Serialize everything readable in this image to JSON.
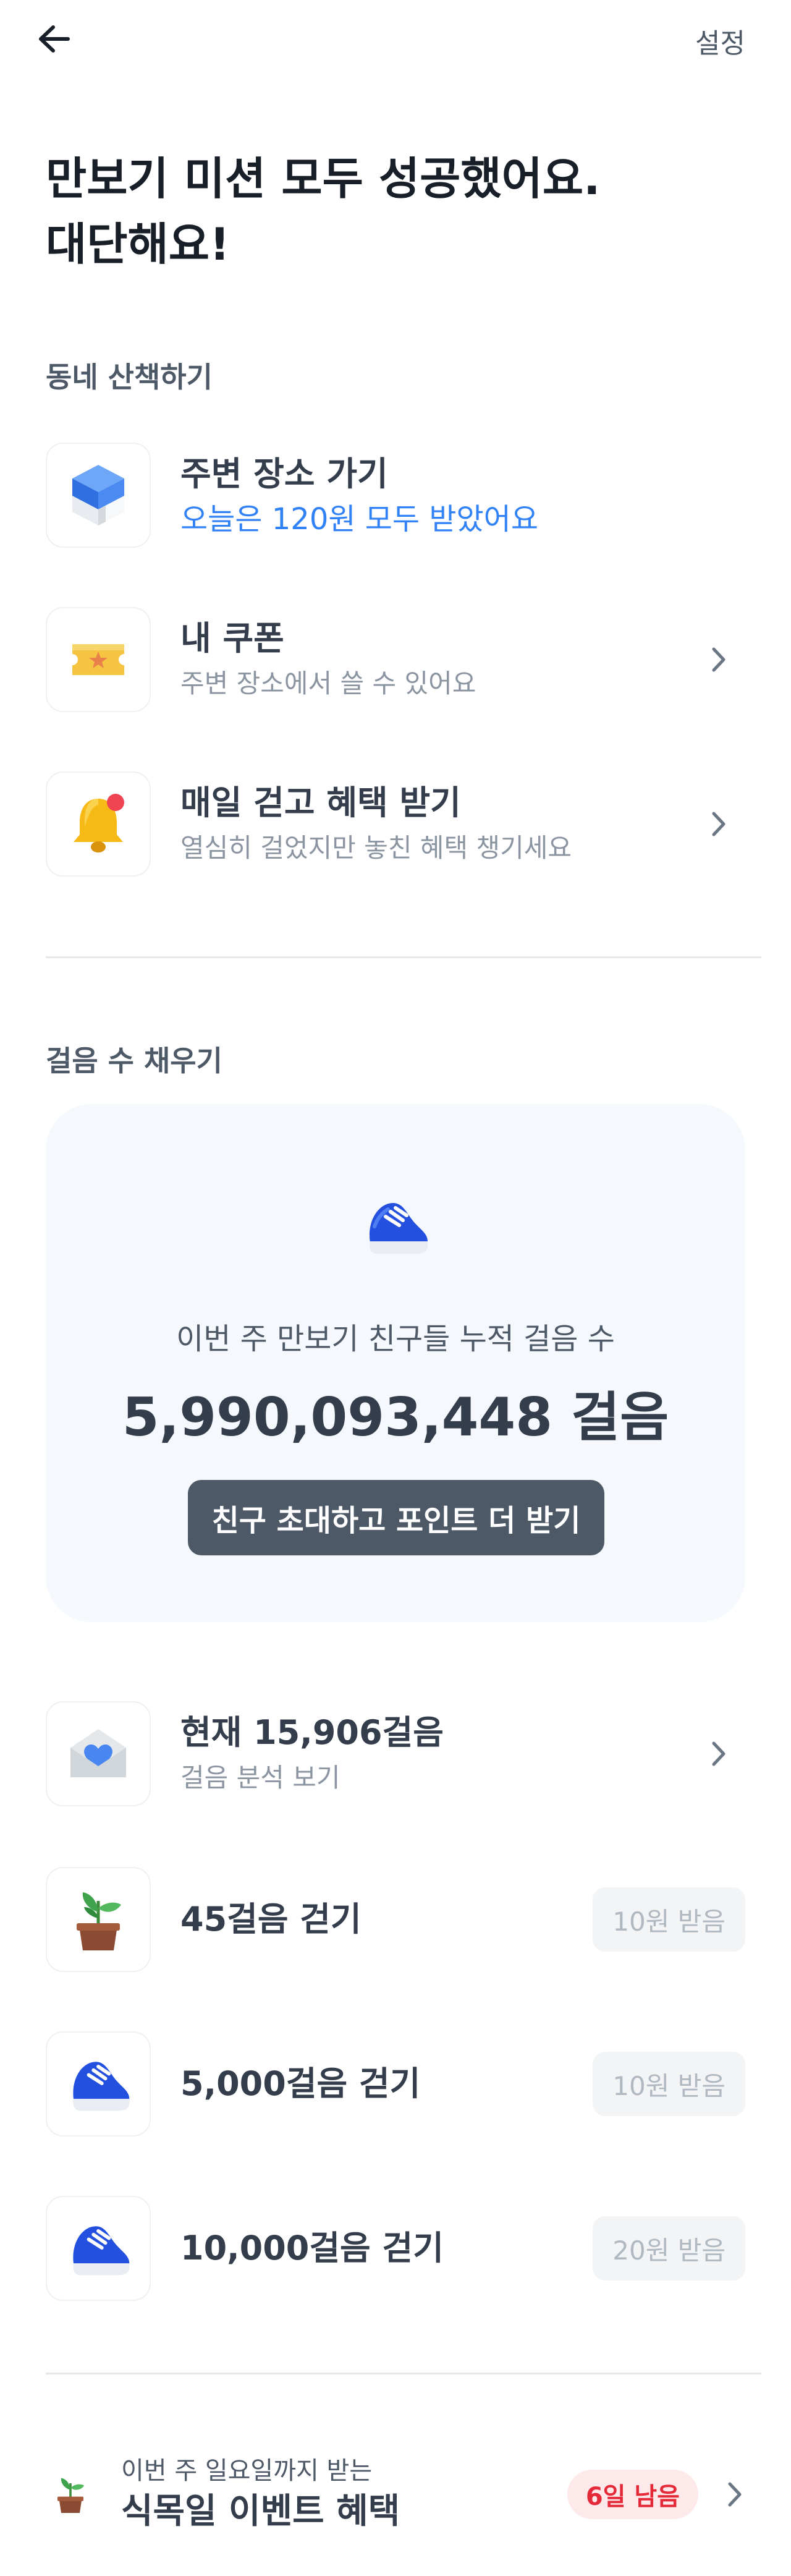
{
  "header": {
    "back_icon": "arrow-left-icon",
    "settings_label": "설정"
  },
  "hero": {
    "title_line1": "만보기 미션 모두 성공했어요.",
    "title_line2": "대단해요!"
  },
  "neighborhood": {
    "section_label": "동네 산책하기",
    "items": [
      {
        "icon": "blue-cube-icon",
        "title": "주변 장소 가기",
        "subtitle": "오늘은 120원 모두 받았어요"
      },
      {
        "icon": "ticket-icon",
        "title": "내 쿠폰",
        "subtitle": "주변 장소에서 쓸 수 있어요"
      },
      {
        "icon": "bell-icon",
        "title": "매일 걷고 혜택 받기",
        "subtitle": "열심히 걸었지만 놓친 혜택 챙기세요"
      }
    ]
  },
  "steps": {
    "section_label": "걸음 수 채우기",
    "card": {
      "icon": "sneaker-icon",
      "caption": "이번 주 만보기 친구들 누적 걸음 수",
      "total": "5,990,093,448 걸음",
      "invite_button": "친구 초대하고 포인트 더 받기"
    },
    "current": {
      "icon": "envelope-heart-icon",
      "title": "현재 15,906걸음",
      "subtitle": "걸음 분석 보기"
    },
    "missions": [
      {
        "icon": "plant-pot-icon",
        "title": "45걸음 걷기",
        "reward": "10원 받음"
      },
      {
        "icon": "sneaker-icon",
        "title": "5,000걸음 걷기",
        "reward": "10원 받음"
      },
      {
        "icon": "sneaker-icon",
        "title": "10,000걸음 걷기",
        "reward": "20원 받음"
      }
    ]
  },
  "event": {
    "icon": "plant-pot-icon",
    "subtitle": "이번 주 일요일까지 받는",
    "title": "식목일 이벤트 혜택",
    "badge": "6일 남음",
    "badge_color": "#e42939"
  },
  "colors": {
    "accent_blue": "#3182f6",
    "button_dark": "#4e5968",
    "card_bg": "#f5f8fc"
  }
}
